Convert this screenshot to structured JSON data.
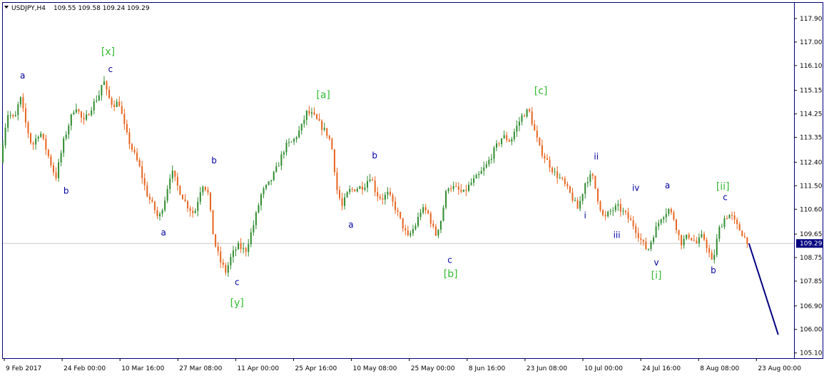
{
  "header": {
    "symbol": "USDJPY,H4",
    "ohlc": "109.55 109.58 109.24 109.29"
  },
  "colors": {
    "frame": "#000080",
    "up_candle": "#2e8b2e",
    "down_candle": "#e8641e",
    "wave_dark": "#0000a0",
    "wave_green": "#33bb33",
    "projection": "#000080",
    "current_price_bg": "#000080",
    "price_line": "#c0c0c0"
  },
  "chart_data": {
    "type": "candlestick",
    "symbol": "USDJPY",
    "timeframe": "H4",
    "ylim": [
      104.9,
      118.5
    ],
    "y_ticks": [
      "117.90",
      "117.00",
      "116.10",
      "115.15",
      "114.25",
      "113.35",
      "112.40",
      "111.50",
      "110.60",
      "109.65",
      "108.75",
      "107.85",
      "106.90",
      "106.00",
      "105.10"
    ],
    "x_ticks": [
      "9 Feb 2017",
      "24 Feb 00:00",
      "10 Mar 16:00",
      "27 Mar 08:00",
      "11 Apr 00:00",
      "25 Apr 16:00",
      "10 May 08:00",
      "25 May 00:00",
      "8 Jun 16:00",
      "23 Jun 08:00",
      "10 Jul 00:00",
      "24 Jul 16:00",
      "8 Aug 08:00",
      "23 Aug 00:00"
    ],
    "current_price": "109.29",
    "path_points": [
      [
        0.0,
        112.4
      ],
      [
        0.5,
        113.6
      ],
      [
        1.0,
        114.3
      ],
      [
        1.8,
        114.0
      ],
      [
        2.5,
        114.9
      ],
      [
        3.2,
        113.9
      ],
      [
        4.0,
        113.0
      ],
      [
        5.0,
        113.6
      ],
      [
        6.0,
        112.7
      ],
      [
        7.0,
        111.8
      ],
      [
        8.0,
        113.2
      ],
      [
        8.8,
        114.0
      ],
      [
        9.5,
        114.6
      ],
      [
        10.5,
        113.9
      ],
      [
        11.5,
        114.5
      ],
      [
        12.5,
        115.0
      ],
      [
        13.0,
        115.6
      ],
      [
        13.5,
        115.0
      ],
      [
        14.2,
        114.6
      ],
      [
        15.0,
        114.7
      ],
      [
        15.8,
        113.6
      ],
      [
        16.5,
        113.0
      ],
      [
        17.5,
        112.3
      ],
      [
        18.5,
        111.2
      ],
      [
        19.5,
        110.6
      ],
      [
        20.0,
        110.2
      ],
      [
        20.8,
        111.0
      ],
      [
        21.6,
        112.1
      ],
      [
        22.5,
        111.4
      ],
      [
        23.5,
        110.8
      ],
      [
        24.5,
        110.4
      ],
      [
        25.5,
        111.6
      ],
      [
        26.2,
        111.3
      ],
      [
        27.0,
        109.4
      ],
      [
        27.8,
        108.6
      ],
      [
        28.5,
        108.2
      ],
      [
        29.2,
        108.8
      ],
      [
        30.0,
        109.2
      ],
      [
        31.0,
        109.0
      ],
      [
        32.0,
        110.0
      ],
      [
        33.0,
        111.2
      ],
      [
        34.0,
        111.6
      ],
      [
        35.0,
        112.2
      ],
      [
        36.0,
        113.0
      ],
      [
        37.0,
        113.2
      ],
      [
        38.0,
        113.7
      ],
      [
        38.7,
        114.3
      ],
      [
        39.5,
        114.2
      ],
      [
        40.5,
        113.8
      ],
      [
        41.5,
        113.4
      ],
      [
        42.0,
        112.8
      ],
      [
        42.5,
        111.4
      ],
      [
        43.2,
        110.7
      ],
      [
        44.0,
        111.3
      ],
      [
        45.0,
        111.4
      ],
      [
        46.0,
        111.5
      ],
      [
        46.8,
        111.9
      ],
      [
        47.5,
        111.2
      ],
      [
        48.2,
        111.0
      ],
      [
        49.0,
        111.2
      ],
      [
        50.0,
        110.6
      ],
      [
        50.8,
        110.0
      ],
      [
        51.5,
        109.5
      ],
      [
        52.5,
        110.0
      ],
      [
        53.2,
        110.6
      ],
      [
        54.0,
        110.5
      ],
      [
        55.0,
        109.6
      ],
      [
        55.7,
        110.2
      ],
      [
        56.5,
        111.5
      ],
      [
        57.5,
        111.4
      ],
      [
        58.5,
        111.2
      ],
      [
        59.5,
        111.6
      ],
      [
        60.5,
        111.9
      ],
      [
        61.5,
        112.3
      ],
      [
        62.5,
        112.9
      ],
      [
        63.5,
        113.4
      ],
      [
        64.5,
        113.2
      ],
      [
        65.0,
        113.6
      ],
      [
        66.0,
        114.2
      ],
      [
        66.8,
        114.4
      ],
      [
        67.5,
        113.6
      ],
      [
        68.2,
        112.9
      ],
      [
        69.0,
        112.5
      ],
      [
        70.0,
        112.0
      ],
      [
        71.0,
        111.7
      ],
      [
        72.0,
        111.2
      ],
      [
        73.0,
        110.6
      ],
      [
        74.0,
        111.7
      ],
      [
        74.8,
        111.9
      ],
      [
        75.6,
        110.9
      ],
      [
        76.3,
        110.2
      ],
      [
        77.0,
        110.5
      ],
      [
        78.0,
        110.7
      ],
      [
        79.0,
        110.4
      ],
      [
        80.0,
        110.0
      ],
      [
        81.0,
        109.4
      ],
      [
        81.8,
        109.0
      ],
      [
        82.5,
        109.6
      ],
      [
        83.5,
        110.3
      ],
      [
        84.5,
        110.6
      ],
      [
        85.2,
        110.2
      ],
      [
        86.0,
        109.3
      ],
      [
        87.0,
        109.6
      ],
      [
        88.0,
        109.3
      ],
      [
        88.8,
        109.6
      ],
      [
        89.5,
        109.0
      ],
      [
        90.0,
        108.5
      ],
      [
        90.8,
        109.8
      ],
      [
        91.6,
        110.3
      ],
      [
        92.3,
        110.4
      ],
      [
        93.0,
        110.0
      ],
      [
        93.7,
        109.7
      ],
      [
        94.3,
        109.4
      ]
    ],
    "projection": [
      [
        94.3,
        109.29
      ],
      [
        98.0,
        105.8
      ]
    ],
    "wave_labels": [
      {
        "text": "a",
        "style": "dark",
        "x": 2.5,
        "y": 115.6
      },
      {
        "text": "b",
        "style": "dark",
        "x": 8.0,
        "y": 111.2
      },
      {
        "text": "[x]",
        "style": "green",
        "x": 13.3,
        "y": 116.5
      },
      {
        "text": "c",
        "style": "dark",
        "x": 13.6,
        "y": 115.85
      },
      {
        "text": "a",
        "style": "dark",
        "x": 20.3,
        "y": 109.6
      },
      {
        "text": "b",
        "style": "dark",
        "x": 26.7,
        "y": 112.35
      },
      {
        "text": "c",
        "style": "dark",
        "x": 29.6,
        "y": 107.7
      },
      {
        "text": "[y]",
        "style": "green",
        "x": 29.6,
        "y": 106.9
      },
      {
        "text": "[a]",
        "style": "green",
        "x": 40.5,
        "y": 114.85
      },
      {
        "text": "a",
        "style": "dark",
        "x": 44.0,
        "y": 109.9
      },
      {
        "text": "b",
        "style": "dark",
        "x": 47.0,
        "y": 112.55
      },
      {
        "text": "c",
        "style": "dark",
        "x": 56.5,
        "y": 108.55
      },
      {
        "text": "[b]",
        "style": "green",
        "x": 56.6,
        "y": 108.0
      },
      {
        "text": "[c]",
        "style": "green",
        "x": 68.0,
        "y": 115.0
      },
      {
        "text": "ii",
        "style": "dark",
        "x": 75.0,
        "y": 112.5
      },
      {
        "text": "i",
        "style": "dark",
        "x": 73.6,
        "y": 110.25
      },
      {
        "text": "iii",
        "style": "dark",
        "x": 77.6,
        "y": 109.5
      },
      {
        "text": "iv",
        "style": "dark",
        "x": 80.0,
        "y": 111.3
      },
      {
        "text": "a",
        "style": "dark",
        "x": 84.0,
        "y": 111.4
      },
      {
        "text": "v",
        "style": "dark",
        "x": 82.6,
        "y": 108.45
      },
      {
        "text": "[i]",
        "style": "green",
        "x": 82.6,
        "y": 107.95
      },
      {
        "text": "[ii]",
        "style": "green",
        "x": 91.0,
        "y": 111.35
      },
      {
        "text": "c",
        "style": "dark",
        "x": 91.3,
        "y": 110.95
      },
      {
        "text": "b",
        "style": "dark",
        "x": 89.8,
        "y": 108.15
      }
    ]
  }
}
